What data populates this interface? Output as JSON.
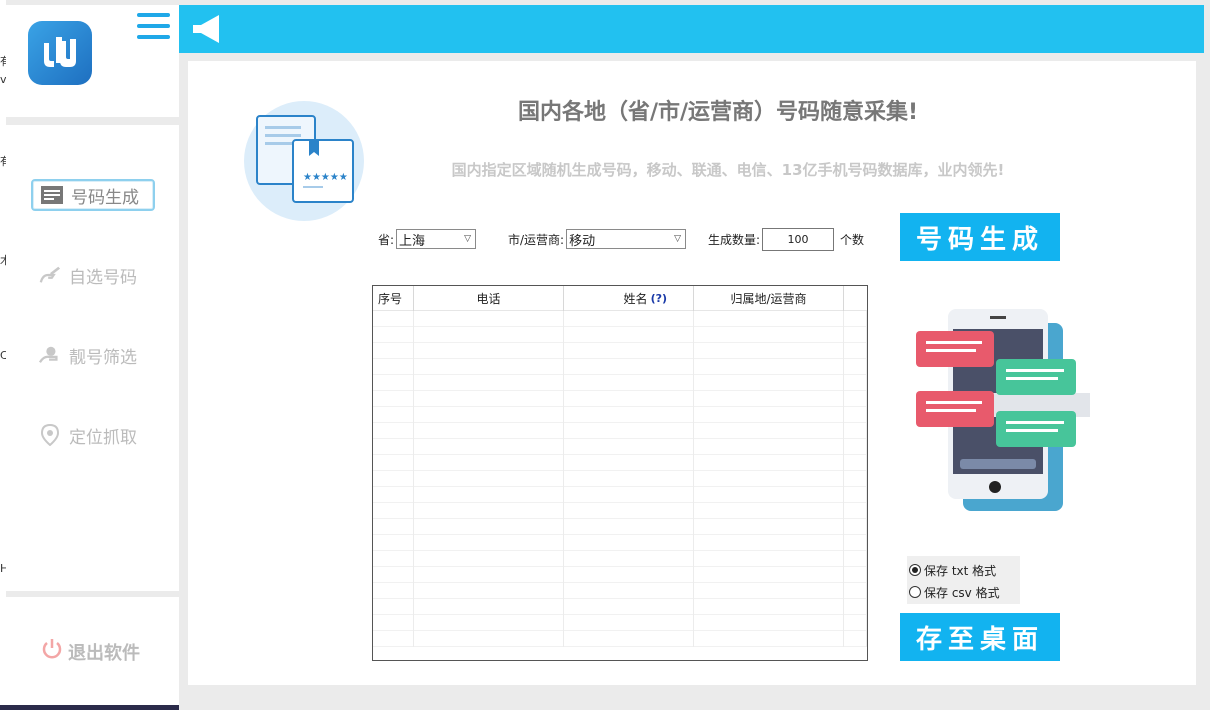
{
  "desktop_edge_chars": [
    "有",
    "v",
    "有",
    "木",
    "C",
    "H"
  ],
  "sidebar": {
    "items": [
      {
        "label": "号码生成",
        "icon": "document-lines-icon",
        "active": true
      },
      {
        "label": "自选号码",
        "icon": "hand-pen-icon",
        "active": false
      },
      {
        "label": "靓号筛选",
        "icon": "hand-coin-icon",
        "active": false
      },
      {
        "label": "定位抓取",
        "icon": "location-pin-icon",
        "active": false
      }
    ],
    "exit_label": "退出软件"
  },
  "header": {
    "title": "国内各地（省/市/运营商）号码随意采集!",
    "subtitle": "国内指定区域随机生成号码，移动、联通、电信、13亿手机号码数据库，业内领先!"
  },
  "form": {
    "province_label": "省:",
    "province_value": "上海",
    "city_label": "市/运营商:",
    "city_value": "移动",
    "count_label": "生成数量:",
    "count_value": "100",
    "count_unit": "个数"
  },
  "buttons": {
    "generate": "号码生成",
    "save_desktop": "存至桌面"
  },
  "table": {
    "columns": [
      "序号",
      "电话",
      "姓名",
      "归属地/运营商"
    ],
    "name_hint": "(?)",
    "rows": []
  },
  "save_format": {
    "options": [
      "保存 txt 格式",
      "保存 csv 格式"
    ],
    "selected": "保存 txt 格式"
  },
  "colors": {
    "accent": "#22c1f0",
    "button": "#12b3f0",
    "exit_icon": "#f3a6a6"
  }
}
